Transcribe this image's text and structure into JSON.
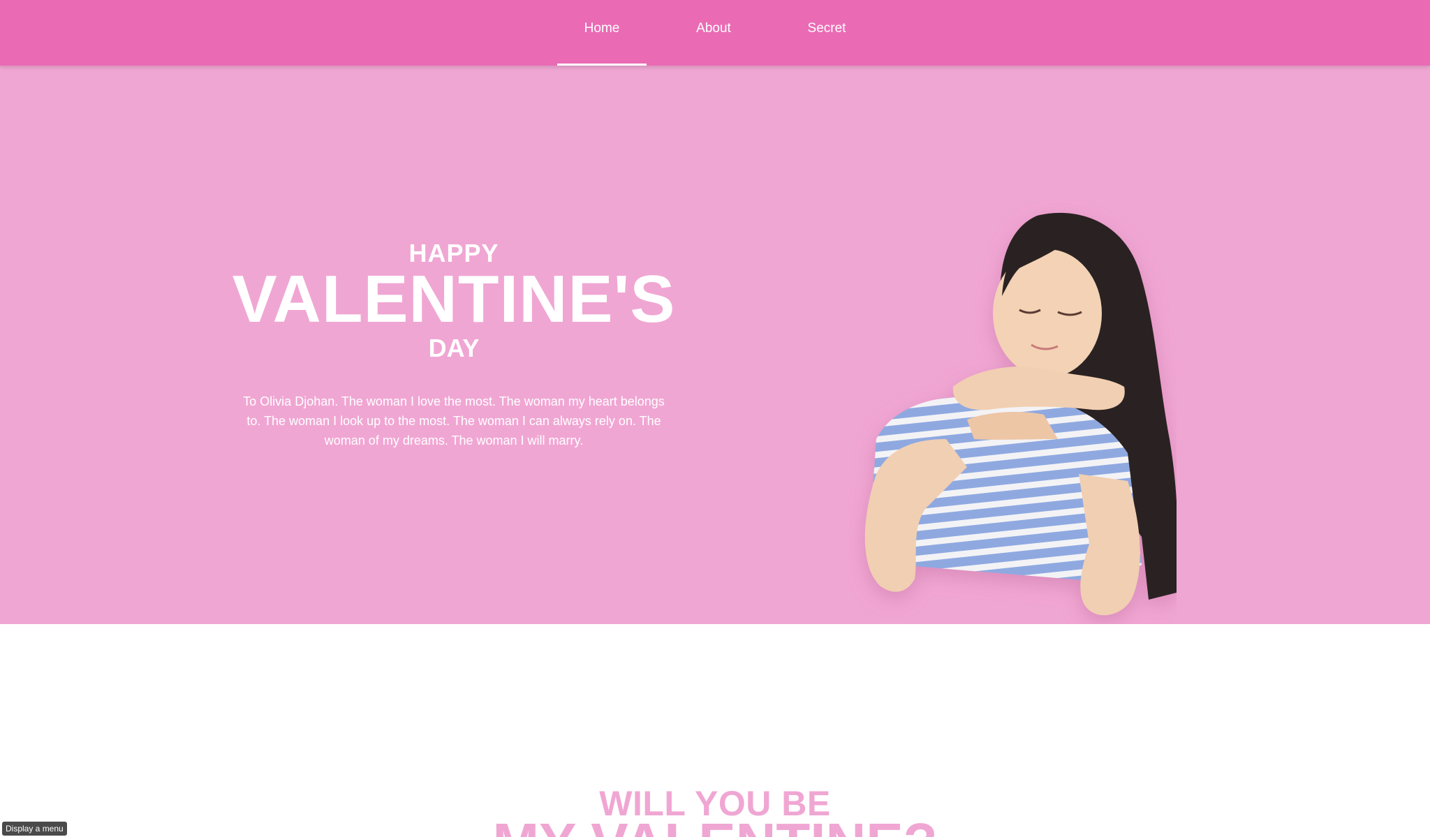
{
  "nav": {
    "tabs": [
      {
        "label": "Home",
        "active": true
      },
      {
        "label": "About",
        "active": false
      },
      {
        "label": "Secret",
        "active": false
      }
    ]
  },
  "hero": {
    "title_top": "HAPPY",
    "title_main": "VALENTINE'S",
    "title_bottom": "DAY",
    "message": "To Olivia Djohan. The woman I love the most. The woman my heart belongs to. The woman I look up to the most. The woman I can always rely on. The woman of my dreams. The woman I will marry."
  },
  "second_section": {
    "line1": "WILL YOU BE",
    "line2": "MY VALENTINE?"
  },
  "tooltip": {
    "text": "Display a menu"
  },
  "colors": {
    "navbar": "#ea6bb4",
    "hero_bg": "#f0a6d3",
    "text_light": "#ffffff",
    "accent_pink": "#f0a6d3"
  }
}
